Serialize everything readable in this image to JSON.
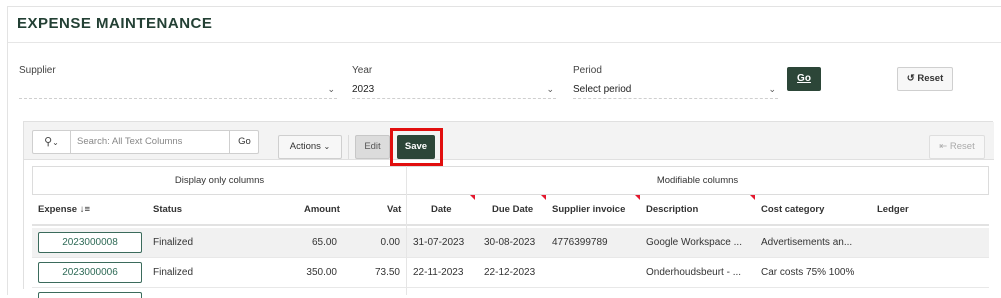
{
  "page": {
    "title": "EXPENSE MAINTENANCE"
  },
  "filters": {
    "supplier_label": "Supplier",
    "supplier_value": "",
    "year_label": "Year",
    "year_value": "2023",
    "period_label": "Period",
    "period_value": "Select period",
    "go_label": "Go",
    "reset_label": "Reset"
  },
  "toolbar": {
    "search_placeholder": "Search: All Text Columns",
    "search_go_label": "Go",
    "actions_label": "Actions",
    "edit_label": "Edit",
    "save_label": "Save",
    "reset_label": "Reset"
  },
  "grid": {
    "group_headers": [
      "Display only columns",
      "Modifiable columns"
    ],
    "columns": {
      "expense": "Expense",
      "status": "Status",
      "amount": "Amount",
      "vat": "Vat",
      "date": "Date",
      "due_date": "Due Date",
      "supplier_invoice": "Supplier invoice",
      "description": "Description",
      "cost_category": "Cost category",
      "ledger": "Ledger"
    },
    "rows": [
      {
        "expense": "2023000008",
        "status": "Finalized",
        "amount": "65.00",
        "vat": "0.00",
        "date": "31-07-2023",
        "due_date": "30-08-2023",
        "supplier_invoice": "4776399789",
        "description": "Google Workspace ...",
        "cost_category": "Advertisements an...",
        "ledger": ""
      },
      {
        "expense": "2023000006",
        "status": "Finalized",
        "amount": "350.00",
        "vat": "73.50",
        "date": "22-11-2023",
        "due_date": "22-12-2023",
        "supplier_invoice": "",
        "description": "Onderhoudsbeurt - ...",
        "cost_category": "Car costs 75% 100%",
        "ledger": ""
      }
    ]
  },
  "colors": {
    "brand": "#2c4638",
    "highlight": "#e10e0e",
    "link": "#2e6a56"
  },
  "icons": [
    "search-icon",
    "chevron-down-icon",
    "sort-descending-icon",
    "undo-icon",
    "export-icon"
  ]
}
